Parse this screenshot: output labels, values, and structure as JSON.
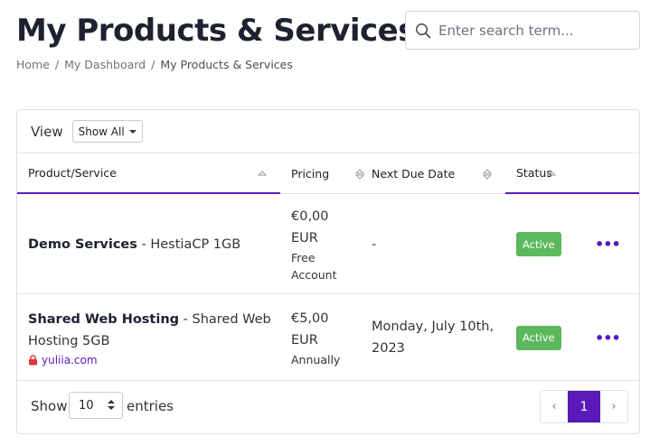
{
  "page": {
    "title": "My Products & Services"
  },
  "search": {
    "placeholder": "Enter search term..."
  },
  "breadcrumb": [
    "Home",
    "My Dashboard",
    "My Products & Services"
  ],
  "view_filter": {
    "label": "View",
    "selected": "Show All"
  },
  "table": {
    "columns": [
      "Product/Service",
      "Pricing",
      "Next Due Date",
      "Status"
    ],
    "rows": [
      {
        "product_name": "Demo Services",
        "product_detail": " - HestiaCP 1GB",
        "price_line1": "€0,00",
        "price_line2": "EUR",
        "cycle_line1": "Free",
        "cycle_line2": "Account",
        "due": "-",
        "status": "Active",
        "actions": "•••"
      },
      {
        "product_name": "Shared Web Hosting",
        "product_detail_1": " - Shared Web",
        "product_detail_2": "Hosting 5GB",
        "domain": "yuliia.com",
        "price_line1": "€5,00",
        "price_line2": "EUR",
        "cycle_line1": "Annually",
        "due_line1": "Monday, July 10th,",
        "due_line2": "2023",
        "status": "Active",
        "actions": "•••"
      }
    ]
  },
  "footer": {
    "show_label": "Show",
    "entries_value": "10",
    "entries_label": "entries",
    "pagination": {
      "prev": "‹",
      "current": "1",
      "next": "›"
    }
  },
  "colors": {
    "accent": "#5a1ab8",
    "active_badge": "#5cb85c",
    "heading": "#1e2230"
  }
}
